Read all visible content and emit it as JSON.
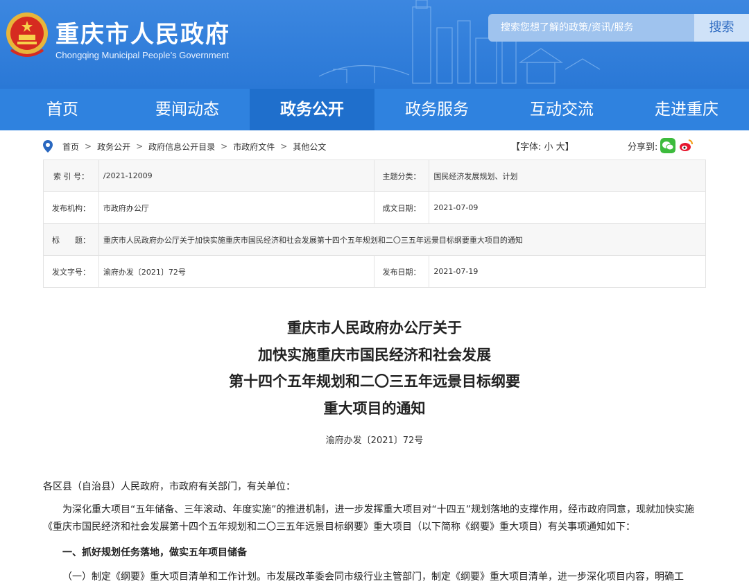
{
  "header": {
    "site_title": "重庆市人民政府",
    "site_subtitle": "Chongqing Municipal People’s Government",
    "search_placeholder": "搜索您想了解的政策/资讯/服务",
    "search_button": "搜索"
  },
  "nav": {
    "items": [
      {
        "label": "首页"
      },
      {
        "label": "要闻动态"
      },
      {
        "label": "政务公开"
      },
      {
        "label": "政务服务"
      },
      {
        "label": "互动交流"
      },
      {
        "label": "走进重庆"
      }
    ],
    "active": "政务公开"
  },
  "breadcrumb": {
    "items": [
      "首页",
      "政务公开",
      "政府信息公开目录",
      "市政府文件",
      "其他公文"
    ],
    "separator": ">"
  },
  "font_control": "【字体: 小 大】",
  "share": {
    "label": "分享到:",
    "icons": [
      "wechat-icon",
      "weibo-icon"
    ]
  },
  "meta": {
    "index_label": "索 引 号：",
    "index_value": "/2021-12009",
    "topic_label": "主题分类：",
    "topic_value": "国民经济发展规划、计划",
    "issuer_label": "发布机构：",
    "issuer_value": "市政府办公厅",
    "written_label": "成文日期：",
    "written_value": "2021-07-09",
    "title_label": "标　　题：",
    "title_value": "重庆市人民政府办公厅关于加快实施重庆市国民经济和社会发展第十四个五年规划和二〇三五年远景目标纲要重大项目的通知",
    "docno_label": "发文字号：",
    "docno_value": "渝府办发〔2021〕72号",
    "published_label": "发布日期：",
    "published_value": "2021-07-19"
  },
  "document": {
    "title_lines": [
      "重庆市人民政府办公厅关于",
      "加快实施重庆市国民经济和社会发展",
      "第十四个五年规划和二〇三五年远景目标纲要",
      "重大项目的通知"
    ],
    "doc_number": "渝府办发〔2021〕72号",
    "addressee": "各区县（自治县）人民政府，市政府有关部门，有关单位：",
    "intro": "为深化重大项目“五年储备、三年滚动、年度实施”的推进机制，进一步发挥重大项目对“十四五”规划落地的支撑作用，经市政府同意，现就加快实施《重庆市国民经济和社会发展第十四个五年规划和二〇三五年远景目标纲要》重大项目（以下简称《纲要》重大项目）有关事项通知如下：",
    "section1": "一、抓好规划任务落地，做实五年项目储备",
    "sub1": "（一）制定《纲要》重大项目清单和工作计划。市发展改革委会同市级行业主管部门，制定《纲要》重大项目清单，进一步深化项目内容，明确工"
  },
  "colors": {
    "header_blue": "#2a78d6",
    "nav_blue": "#2f82df",
    "nav_active": "#1f6fcc",
    "wechat": "#3dbb3d",
    "weibo": "#e6162d"
  }
}
